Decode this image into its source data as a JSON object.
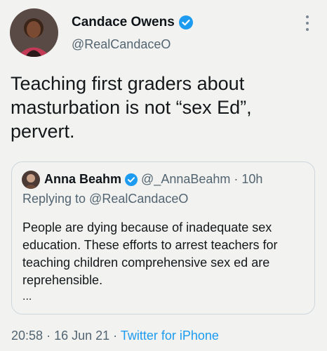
{
  "tweet": {
    "author_name": "Candace Owens",
    "author_handle": "@RealCandaceO",
    "text": "Teaching first graders about masturbation is not “sex Ed”, pervert.",
    "time": "20:58",
    "separator": "·",
    "date": "16 Jun 21",
    "source": "Twitter for iPhone"
  },
  "quoted": {
    "author_name": "Anna Beahm",
    "author_handle": "@_AnnaBeahm",
    "separator": "·",
    "time_ago": "10h",
    "replying_to": "Replying to @RealCandaceO",
    "text": "People are dying because of inadequate sex education. These efforts to arrest teachers for teaching children comprehensive sex ed are reprehensible.",
    "ellipsis": "..."
  },
  "icons": {
    "verified": "verified-badge-icon",
    "more": "more-vertical-icon"
  },
  "colors": {
    "background": "#f2f3f1",
    "accent": "#1d9bf0",
    "secondary_text": "#536471",
    "border": "#cfd6dc"
  }
}
